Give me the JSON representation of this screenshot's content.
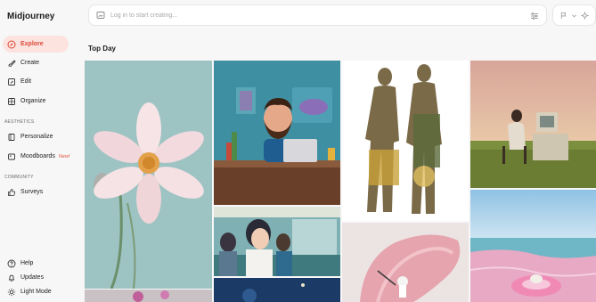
{
  "app": {
    "logo_text": "Midjourney"
  },
  "sidebar": {
    "items": [
      {
        "label": "Explore",
        "icon": "compass-icon"
      },
      {
        "label": "Create",
        "icon": "brush-icon"
      },
      {
        "label": "Edit",
        "icon": "edit-icon"
      },
      {
        "label": "Organize",
        "icon": "grid-icon"
      }
    ],
    "aesthetics_label": "AESTHETICS",
    "aesthetics_items": [
      {
        "label": "Personalize",
        "icon": "book-icon"
      },
      {
        "label": "Moodboards",
        "icon": "moodboard-icon",
        "badge": "New!"
      }
    ],
    "community_label": "COMMUNITY",
    "community_items": [
      {
        "label": "Surveys",
        "icon": "thumbs-up-icon"
      }
    ],
    "bottom_items": [
      {
        "label": "Help",
        "icon": "help-icon"
      },
      {
        "label": "Updates",
        "icon": "bell-icon"
      },
      {
        "label": "Light Mode",
        "icon": "sun-icon"
      }
    ]
  },
  "search": {
    "placeholder": "Log in to start creating..."
  },
  "main": {
    "section_title": "Top Day"
  },
  "colors": {
    "accent": "#d94a36",
    "active_bg": "#fde3e0",
    "badge": "#e0503c"
  }
}
